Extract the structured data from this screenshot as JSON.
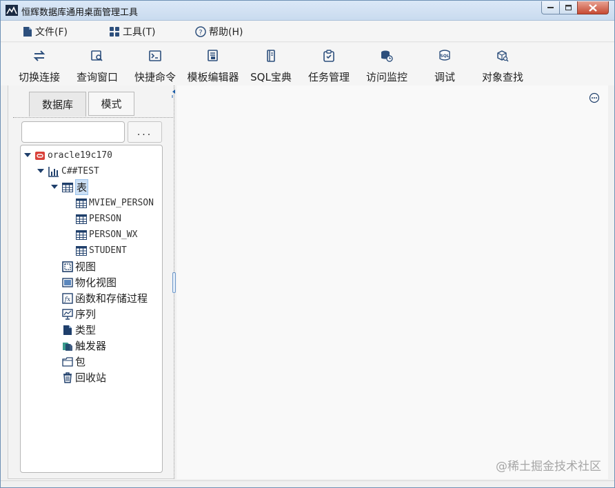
{
  "window": {
    "title": "恒辉数据库通用桌面管理工具"
  },
  "menu": [
    {
      "label": "文件(F)",
      "icon": "file-icon"
    },
    {
      "label": "工具(T)",
      "icon": "grid-icon"
    },
    {
      "label": "帮助(H)",
      "icon": "help-icon"
    }
  ],
  "toolbar": [
    {
      "label": "切换连接",
      "icon": "switch-connection-icon"
    },
    {
      "label": "查询窗口",
      "icon": "query-window-icon"
    },
    {
      "label": "快捷命令",
      "icon": "terminal-icon"
    },
    {
      "label": "模板编辑器",
      "icon": "template-editor-icon"
    },
    {
      "label": "SQL宝典",
      "icon": "sql-book-icon"
    },
    {
      "label": "任务管理",
      "icon": "task-manage-icon"
    },
    {
      "label": "访问监控",
      "icon": "access-monitor-icon"
    },
    {
      "label": "调试",
      "icon": "sql-debug-icon"
    },
    {
      "label": "对象查找",
      "icon": "object-search-icon"
    }
  ],
  "left_panel": {
    "tabs": [
      {
        "label": "数据库",
        "active": true
      },
      {
        "label": "模式",
        "active": false
      }
    ],
    "search": {
      "value": "",
      "placeholder": ""
    },
    "more_button": "..."
  },
  "tree": {
    "connection": "oracle19c170",
    "schema": "C##TEST",
    "tables_label": "表",
    "tables": [
      "MVIEW_PERSON",
      "PERSON",
      "PERSON_WX",
      "STUDENT"
    ],
    "folders": [
      {
        "label": "视图",
        "icon": "view-icon"
      },
      {
        "label": "物化视图",
        "icon": "materialized-view-icon"
      },
      {
        "label": "函数和存储过程",
        "icon": "function-icon"
      },
      {
        "label": "序列",
        "icon": "sequence-icon"
      },
      {
        "label": "类型",
        "icon": "type-icon"
      },
      {
        "label": "触发器",
        "icon": "trigger-icon"
      },
      {
        "label": "包",
        "icon": "package-icon"
      },
      {
        "label": "回收站",
        "icon": "recycle-bin-icon"
      }
    ]
  },
  "watermark": "@稀土掘金技术社区",
  "colors": {
    "accent": "#1f5fa8",
    "selection": "#cce0f5",
    "db_red": "#d9413a"
  }
}
